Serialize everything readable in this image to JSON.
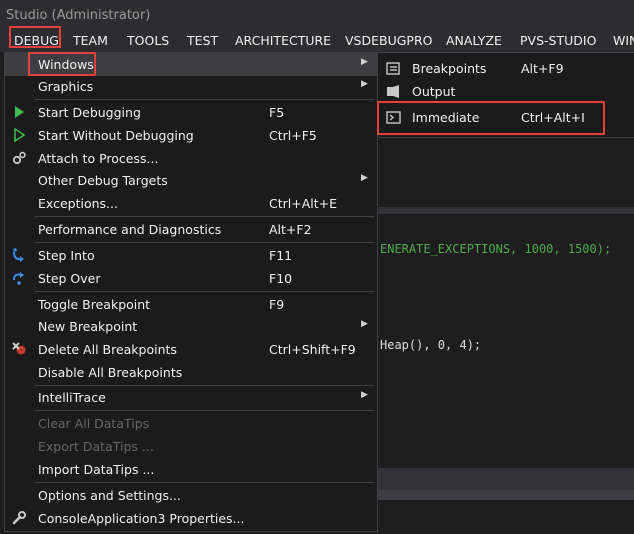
{
  "window": {
    "title": "Studio (Administrator)"
  },
  "menubar": {
    "items": [
      "DEBUG",
      "TEAM",
      "TOOLS",
      "TEST",
      "ARCHITECTURE",
      "VSDEBUGPRO",
      "ANALYZE",
      "PVS-STUDIO",
      "WIN"
    ]
  },
  "debug_menu": {
    "items": [
      {
        "label": "Windows",
        "shortcut": "",
        "submenu": true,
        "icon": ""
      },
      {
        "label": "Graphics",
        "shortcut": "",
        "submenu": true,
        "icon": ""
      },
      {
        "label": "Start Debugging",
        "shortcut": "F5",
        "icon": "play-icon"
      },
      {
        "label": "Start Without Debugging",
        "shortcut": "Ctrl+F5",
        "icon": "play-outline-icon"
      },
      {
        "label": "Attach to Process...",
        "shortcut": "",
        "icon": "gears-icon"
      },
      {
        "label": "Other Debug Targets",
        "shortcut": "",
        "submenu": true
      },
      {
        "label": "Exceptions...",
        "shortcut": "Ctrl+Alt+E"
      },
      {
        "label": "Performance and Diagnostics",
        "shortcut": "Alt+F2"
      },
      {
        "label": "Step Into",
        "shortcut": "F11",
        "icon": "step-into-icon"
      },
      {
        "label": "Step Over",
        "shortcut": "F10",
        "icon": "step-over-icon"
      },
      {
        "label": "Toggle Breakpoint",
        "shortcut": "F9"
      },
      {
        "label": "New Breakpoint",
        "shortcut": "",
        "submenu": true
      },
      {
        "label": "Delete All Breakpoints",
        "shortcut": "Ctrl+Shift+F9",
        "icon": "delete-breakpoints-icon"
      },
      {
        "label": "Disable All Breakpoints",
        "shortcut": ""
      },
      {
        "label": "IntelliTrace",
        "shortcut": "",
        "submenu": true
      },
      {
        "label": "Clear All DataTips",
        "shortcut": "",
        "disabled": true
      },
      {
        "label": "Export DataTips ...",
        "shortcut": "",
        "disabled": true
      },
      {
        "label": "Import DataTips ...",
        "shortcut": ""
      },
      {
        "label": "Options and Settings...",
        "shortcut": ""
      },
      {
        "label": "ConsoleApplication3 Properties...",
        "shortcut": "",
        "icon": "wrench-icon"
      }
    ]
  },
  "windows_submenu": {
    "items": [
      {
        "label": "Breakpoints",
        "shortcut": "Alt+F9",
        "icon": "breakpoints-icon"
      },
      {
        "label": "Output",
        "shortcut": "",
        "icon": "output-icon"
      },
      {
        "label": "Immediate",
        "shortcut": "Ctrl+Alt+I",
        "icon": "immediate-icon"
      }
    ]
  },
  "editor": {
    "code_line_1": "ENERATE_EXCEPTIONS, 1000, 1500);",
    "code_line_2": "Heap(), 0, 4);"
  },
  "colors": {
    "highlight": "#e8403a",
    "menu_bg": "#1b1b1c",
    "selected_bg": "#3e3e40",
    "accent_green": "#57a64a"
  }
}
